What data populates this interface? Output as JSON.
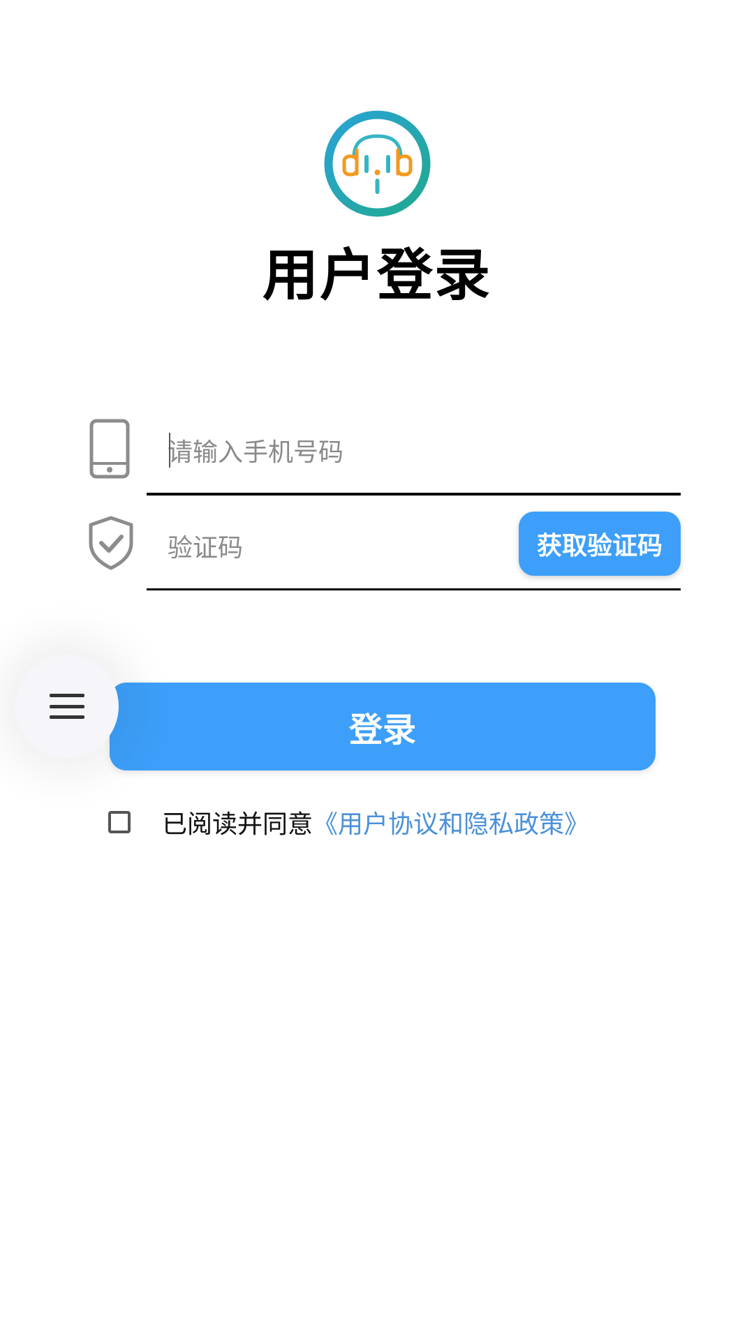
{
  "title": "用户登录",
  "phone": {
    "placeholder": "请输入手机号码",
    "value": ""
  },
  "code": {
    "placeholder": "验证码",
    "value": "",
    "button_label": "获取验证码"
  },
  "login_label": "登录",
  "agreement": {
    "checked": false,
    "prefix": "已阅读并同意",
    "link_label": "《用户协议和隐私政策》"
  },
  "icons": {
    "logo": "headphones-logo-icon",
    "phone": "smartphone-icon",
    "code": "shield-check-icon",
    "menu": "menu-icon"
  },
  "colors": {
    "primary": "#3d9ff9",
    "link": "#4a90d9",
    "logo_teal": "#21a6a0",
    "logo_orange": "#f39a1e",
    "icon_gray": "#8c8c8c"
  }
}
